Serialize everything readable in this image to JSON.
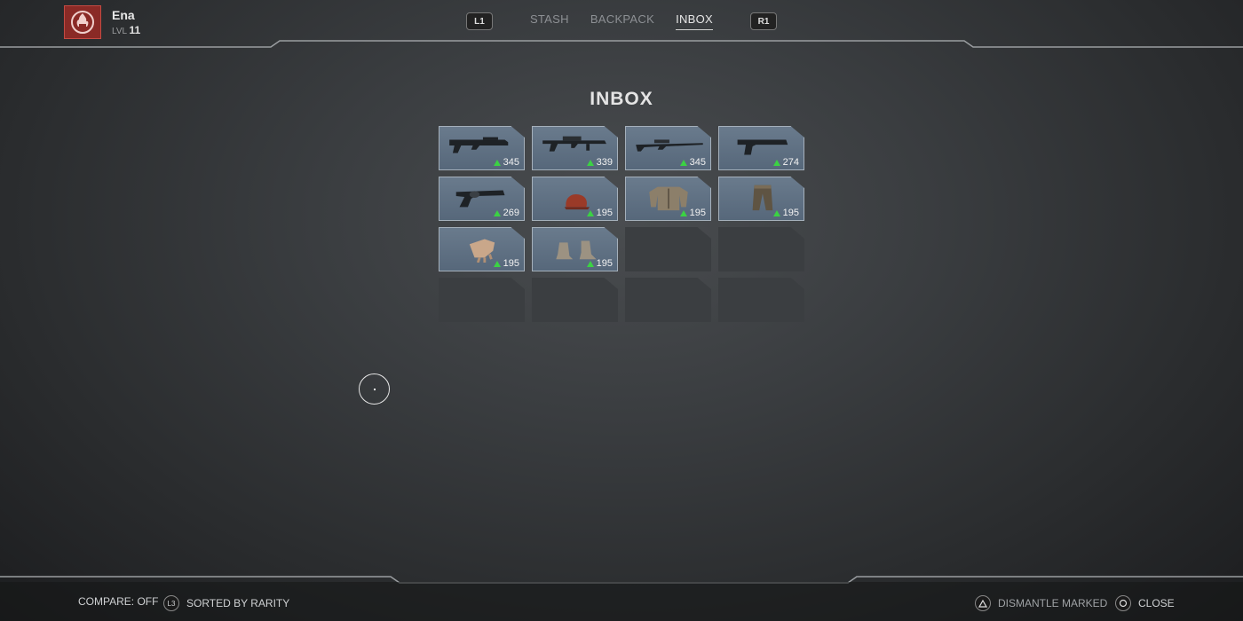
{
  "player": {
    "name": "Ena",
    "level_prefix": "LVL",
    "level": "11",
    "icon": "flame-fist-icon"
  },
  "nav": {
    "left_button": "L1",
    "right_button": "R1",
    "tabs": [
      {
        "label": "STASH",
        "active": false
      },
      {
        "label": "BACKPACK",
        "active": false
      },
      {
        "label": "INBOX",
        "active": true
      }
    ]
  },
  "title": "INBOX",
  "items": [
    {
      "type": "assault-rifle",
      "power": "345"
    },
    {
      "type": "heavy-rifle",
      "power": "339"
    },
    {
      "type": "sniper-rifle",
      "power": "345"
    },
    {
      "type": "pistol",
      "power": "274"
    },
    {
      "type": "revolver",
      "power": "269"
    },
    {
      "type": "hat",
      "power": "195"
    },
    {
      "type": "jacket",
      "power": "195"
    },
    {
      "type": "pants",
      "power": "195"
    },
    {
      "type": "gloves",
      "power": "195"
    },
    {
      "type": "boots",
      "power": "195"
    }
  ],
  "empty_slots": 6,
  "footer": {
    "compare": "COMPARE: OFF",
    "sort_button": "L3",
    "sort": "SORTED BY RARITY",
    "dismantle": "DISMANTLE MARKED",
    "close": "CLOSE"
  },
  "colors": {
    "accent": "#8a2a26",
    "power_up": "#3bd243",
    "item_bg": "#5f7083"
  }
}
